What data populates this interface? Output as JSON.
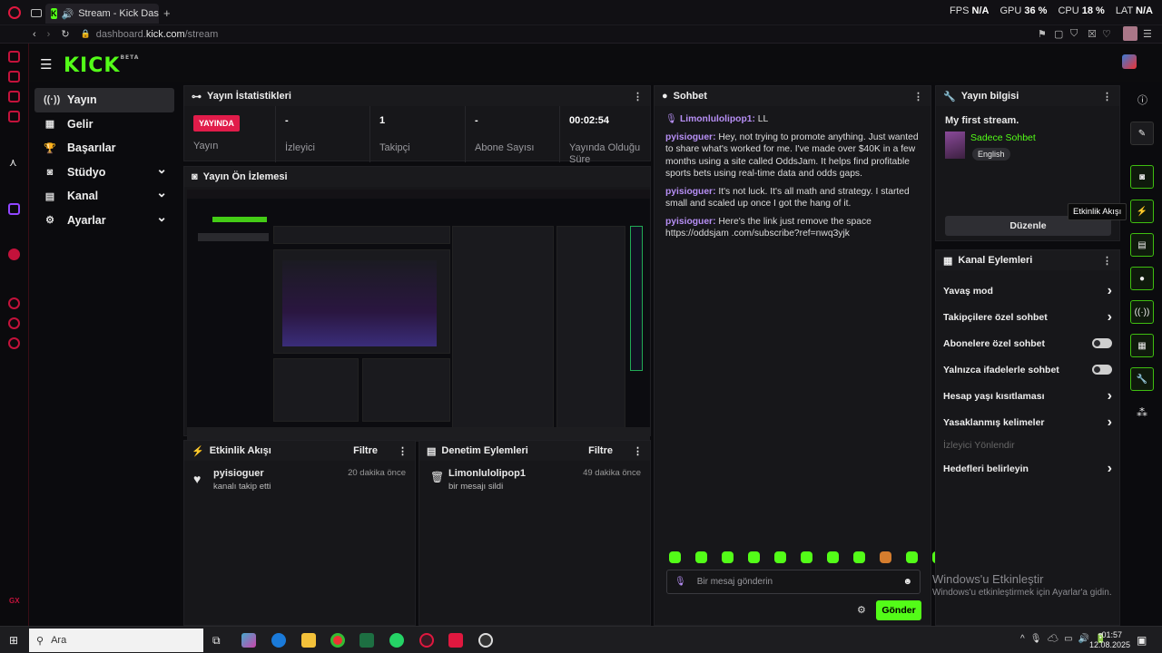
{
  "browser": {
    "tab_title": "Stream - Kick Dashbo",
    "url_prefix": "dashboard.",
    "url_domain": "kick.com",
    "url_path": "/stream",
    "stats": [
      {
        "label": "FPS",
        "value": "N/A"
      },
      {
        "label": "GPU",
        "value": "36 %"
      },
      {
        "label": "CPU",
        "value": "18 %"
      },
      {
        "label": "LAT",
        "value": "N/A"
      }
    ]
  },
  "app": {
    "logo": "KICK",
    "logo_sup": "BETA"
  },
  "nav": [
    {
      "label": "Yayın",
      "icon": "broadcast-icon",
      "active": true
    },
    {
      "label": "Gelir",
      "icon": "bank-icon"
    },
    {
      "label": "Başarılar",
      "icon": "trophy-icon"
    },
    {
      "label": "Stüdyo",
      "icon": "studio-icon",
      "chevron": true
    },
    {
      "label": "Kanal",
      "icon": "channel-icon",
      "chevron": true
    },
    {
      "label": "Ayarlar",
      "icon": "gear-icon",
      "chevron": true
    }
  ],
  "stats_panel": {
    "title": "Yayın İstatistikleri",
    "live_badge": "YAYINDA",
    "live_label": "Yayın",
    "cells": [
      {
        "value": "-",
        "label": "İzleyici"
      },
      {
        "value": "1",
        "label": "Takipçi"
      },
      {
        "value": "-",
        "label": "Abone Sayısı"
      },
      {
        "value": "00:02:54",
        "label": "Yayında Olduğu Süre"
      }
    ]
  },
  "preview_panel": {
    "title": "Yayın Ön İzlemesi"
  },
  "activity": {
    "title": "Etkinlik Akışı",
    "filter": "Filtre",
    "items": [
      {
        "user": "pyisioguer",
        "action": "kanalı takip etti",
        "time": "20 dakika önce"
      }
    ]
  },
  "moderation": {
    "title": "Denetim Eylemleri",
    "filter": "Filtre",
    "items": [
      {
        "user": "Limonlulolipop1",
        "action": "bir mesajı sildi",
        "time": "49 dakika önce"
      }
    ]
  },
  "chat": {
    "title": "Sohbet",
    "pinned_user": "Limonlulolipop1:",
    "pinned_text": "LL",
    "messages": [
      {
        "user": "pyisioguer:",
        "text": "Hey, not trying to promote anything. Just wanted to share what's worked for me. I've made over $40K in a few months using a site called OddsJam. It helps find profitable sports bets using real-time data and odds gaps."
      },
      {
        "user": "pyisioguer:",
        "text": "It's not luck. It's all math and strategy. I started small and scaled up once I got the hang of it."
      },
      {
        "user": "pyisioguer:",
        "text": "Here's the link just remove the space https://oddsjam .com/subscribe?ref=nwq3yjk"
      }
    ],
    "placeholder": "Bir mesaj gönderin",
    "send": "Gönder"
  },
  "stream_info": {
    "title": "Yayın bilgisi",
    "stream_title": "My first stream.",
    "category": "Sadece Sohbet",
    "language": "English",
    "edit": "Düzenle"
  },
  "channel_actions": {
    "title": "Kanal Eylemleri",
    "items": [
      {
        "label": "Yavaş mod",
        "type": "chevron"
      },
      {
        "label": "Takipçilere özel sohbet",
        "type": "chevron"
      },
      {
        "label": "Abonelere özel sohbet",
        "type": "toggle"
      },
      {
        "label": "Yalnızca ifadelerle sohbet",
        "type": "toggle"
      },
      {
        "label": "Hesap yaşı kısıtlaması",
        "type": "chevron"
      },
      {
        "label": "Yasaklanmış kelimeler",
        "type": "chevron"
      },
      {
        "label": "İzleyici Yönlendir",
        "type": "disabled"
      },
      {
        "label": "Hedefleri belirleyin",
        "type": "chevron"
      }
    ]
  },
  "tooltip": "Etkinlik Akışı",
  "watermark": {
    "line1": "Windows'u Etkinleştir",
    "line2": "Windows'u etkinleştirmek için Ayarlar'a gidin."
  },
  "taskbar": {
    "search": "Ara",
    "time": "01:57",
    "date": "12.08.2025"
  },
  "colors": {
    "accent": "#53fc18",
    "live": "#e11c4a",
    "username": "#b78ff5"
  }
}
